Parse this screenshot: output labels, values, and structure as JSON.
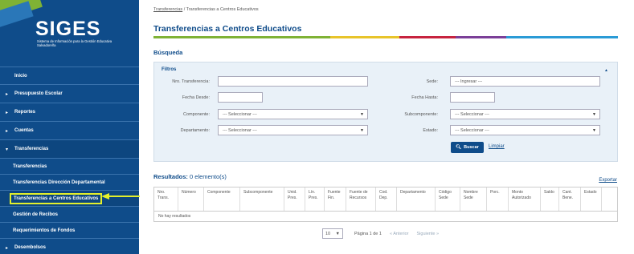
{
  "sidebar": {
    "logo_title": "SIGES",
    "logo_subtitle": "Sistema de Información para la Gestión Educativa Salvadoreña",
    "items": [
      {
        "label": "Inicio"
      },
      {
        "label": "Presupuesto Escolar"
      },
      {
        "label": "Reportes"
      },
      {
        "label": "Cuentas"
      },
      {
        "label": "Transferencias"
      }
    ],
    "sub_items": [
      {
        "label": "Transferencias"
      },
      {
        "label": "Transferencias Dirección Departamental"
      },
      {
        "label": "Transferencias a Centros Educativos"
      },
      {
        "label": "Gestión de Recibos"
      },
      {
        "label": "Requerimientos de Fondos"
      }
    ],
    "after_items": [
      {
        "label": "Desembolsos"
      }
    ]
  },
  "breadcrumb": {
    "parent": "Transferencias",
    "separator": "/",
    "current": "Transferencias a Centros Educativos"
  },
  "page_title": "Transferencias a Centros Educativos",
  "search": {
    "section_title": "Búsqueda",
    "filters_title": "Filtros",
    "fields": {
      "nro_transferencia": {
        "label": "Nro. Transferencia:",
        "value": ""
      },
      "sede": {
        "label": "Sede:",
        "placeholder": "--- Ingresar ---"
      },
      "fecha_desde": {
        "label": "Fecha Desde:",
        "value": ""
      },
      "fecha_hasta": {
        "label": "Fecha Hasta:",
        "value": ""
      },
      "componente": {
        "label": "Componente:",
        "selected": "--- Seleccionar ---"
      },
      "subcomponente": {
        "label": "Subcomponente:",
        "selected": "--- Seleccionar ---"
      },
      "departamento": {
        "label": "Departamento:",
        "selected": "--- Seleccionar ---"
      },
      "estado": {
        "label": "Estado:",
        "selected": "--- Seleccionar ---"
      }
    },
    "buscar_label": "Buscar",
    "limpiar_label": "Limpiar"
  },
  "results": {
    "title": "Resultados:",
    "count_text": "0 elemento(s)",
    "export_label": "Exportar",
    "columns": [
      "Nro. Trans.",
      "Número",
      "Componente",
      "Subcomponente",
      "Unid. Pres.",
      "Lín. Pres.",
      "Fuente Fin.",
      "Fuente de Recursos",
      "Cod. Dep.",
      "Departamento",
      "Código Sede",
      "Nombre Sede",
      "Porc.",
      "Monto Autorizado",
      "Saldo",
      "Cant. Bene.",
      "Estado"
    ],
    "empty_text": "No hay resultados"
  },
  "pagination": {
    "page_size": "10",
    "page_text": "Página 1 de 1",
    "prev_label": "« Anterior",
    "next_label": "Siguiente »"
  },
  "colors": {
    "brand_blue": "#0f4c8a",
    "highlight": "#e3ef2c",
    "bar": [
      "#7fb235",
      "#e8c42a",
      "#c7233f",
      "#7b3f98",
      "#2a9bd6"
    ]
  }
}
